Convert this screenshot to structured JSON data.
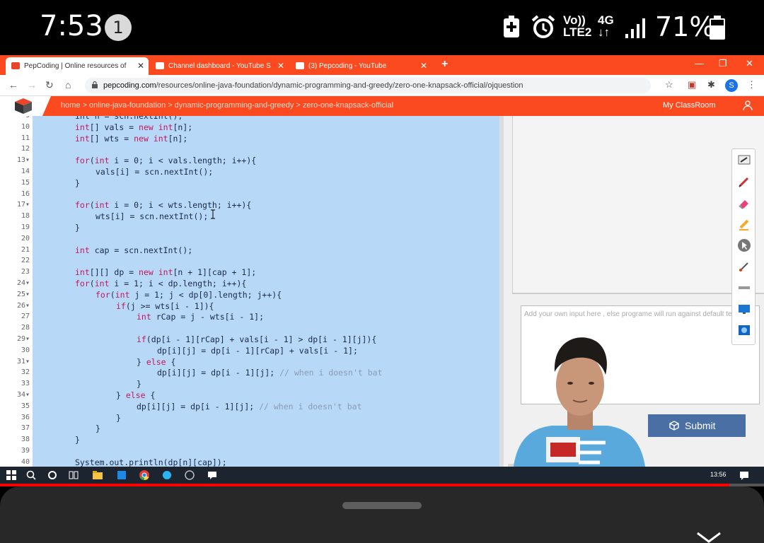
{
  "status_bar": {
    "time": "7:53",
    "notification_count": "1",
    "volte_line1": "Vo))",
    "volte_line2": "LTE2",
    "network_line1": "4G",
    "network_line2": "↓↑",
    "battery_percent": "71%",
    "icons": [
      "battery-saver-icon",
      "alarm-icon",
      "signal-icon",
      "battery-icon"
    ]
  },
  "browser": {
    "tabs": [
      {
        "label": "PepCoding | Online resources of",
        "active": true
      },
      {
        "label": "Channel dashboard - YouTube S",
        "active": false
      },
      {
        "label": "(3) Pepcoding - YouTube",
        "active": false
      }
    ],
    "url_host": "pepcoding.com",
    "url_path": "/resources/online-java-foundation/dynamic-programming-and-greedy/zero-one-knapsack-official/ojquestion"
  },
  "site": {
    "breadcrumb": [
      "home",
      "online-java-foundation",
      "dynamic-programming-and-greedy",
      "zero-one-knapsack-official"
    ],
    "breadcrumb_sep": ">",
    "my_classroom": "My ClassRoom"
  },
  "editor": {
    "lines": [
      {
        "n": "9",
        "indent": 0,
        "parts": [
          [
            "int n = scn.nextInt();",
            "p"
          ]
        ]
      },
      {
        "n": "10",
        "indent": 0,
        "parts": [
          [
            "int",
            "k"
          ],
          [
            "[] vals = ",
            "p"
          ],
          [
            "new int",
            "k"
          ],
          [
            "[n];",
            "p"
          ]
        ]
      },
      {
        "n": "11",
        "indent": 0,
        "parts": [
          [
            "int",
            "k"
          ],
          [
            "[] wts = ",
            "p"
          ],
          [
            "new int",
            "k"
          ],
          [
            "[n];",
            "p"
          ]
        ]
      },
      {
        "n": "12",
        "indent": 0,
        "parts": []
      },
      {
        "n": "13",
        "indent": 0,
        "parts": [
          [
            "for",
            "k"
          ],
          [
            "(",
            "p"
          ],
          [
            "int",
            "k"
          ],
          [
            " i = 0; i < vals.length; i++){",
            "p"
          ]
        ]
      },
      {
        "n": "14",
        "indent": 1,
        "parts": [
          [
            "vals[i] = scn.nextInt();",
            "p"
          ]
        ]
      },
      {
        "n": "15",
        "indent": 0,
        "parts": [
          [
            "}",
            "p"
          ]
        ]
      },
      {
        "n": "16",
        "indent": 0,
        "parts": []
      },
      {
        "n": "17",
        "indent": 0,
        "parts": [
          [
            "for",
            "k"
          ],
          [
            "(",
            "p"
          ],
          [
            "int",
            "k"
          ],
          [
            " i = 0; i < wts.length; i++){",
            "p"
          ]
        ]
      },
      {
        "n": "18",
        "indent": 1,
        "parts": [
          [
            "wts[i] = scn.nextInt();",
            "p"
          ]
        ]
      },
      {
        "n": "19",
        "indent": 0,
        "parts": [
          [
            "}",
            "p"
          ]
        ]
      },
      {
        "n": "20",
        "indent": 0,
        "parts": []
      },
      {
        "n": "21",
        "indent": 0,
        "parts": [
          [
            "int",
            "k"
          ],
          [
            " cap = scn.nextInt();",
            "p"
          ]
        ]
      },
      {
        "n": "22",
        "indent": 0,
        "parts": []
      },
      {
        "n": "23",
        "indent": 0,
        "parts": [
          [
            "int",
            "k"
          ],
          [
            "[][] dp = ",
            "p"
          ],
          [
            "new int",
            "k"
          ],
          [
            "[n + 1][cap + 1];",
            "p"
          ]
        ]
      },
      {
        "n": "24",
        "indent": 0,
        "parts": [
          [
            "for",
            "k"
          ],
          [
            "(",
            "p"
          ],
          [
            "int",
            "k"
          ],
          [
            " i = 1; i < dp.length; i++){",
            "p"
          ]
        ]
      },
      {
        "n": "25",
        "indent": 1,
        "parts": [
          [
            "for",
            "k"
          ],
          [
            "(",
            "p"
          ],
          [
            "int",
            "k"
          ],
          [
            " j = 1; j < dp[0].length; j++){",
            "p"
          ]
        ]
      },
      {
        "n": "26",
        "indent": 2,
        "parts": [
          [
            "if",
            "k"
          ],
          [
            "(j >= wts[i - 1]){",
            "p"
          ]
        ]
      },
      {
        "n": "27",
        "indent": 3,
        "parts": [
          [
            "int",
            "k"
          ],
          [
            " rCap = j - wts[i - 1];",
            "p"
          ]
        ]
      },
      {
        "n": "28",
        "indent": 0,
        "parts": []
      },
      {
        "n": "29",
        "indent": 3,
        "parts": [
          [
            "if",
            "k"
          ],
          [
            "(dp[i - 1][rCap] + vals[i - 1] > dp[i - 1][j]){",
            "p"
          ]
        ]
      },
      {
        "n": "30",
        "indent": 4,
        "parts": [
          [
            "dp[i][j] = dp[i - 1][rCap] + vals[i - 1];",
            "p"
          ]
        ]
      },
      {
        "n": "31",
        "indent": 3,
        "parts": [
          [
            "} ",
            "p"
          ],
          [
            "else",
            "k"
          ],
          [
            " {",
            "p"
          ]
        ]
      },
      {
        "n": "32",
        "indent": 4,
        "parts": [
          [
            "dp[i][j] = dp[i - 1][j]; ",
            "p"
          ],
          [
            "// when i doesn't bat",
            "c"
          ]
        ]
      },
      {
        "n": "33",
        "indent": 3,
        "parts": [
          [
            "}",
            "p"
          ]
        ]
      },
      {
        "n": "34",
        "indent": 2,
        "parts": [
          [
            "} ",
            "p"
          ],
          [
            "else",
            "k"
          ],
          [
            " {",
            "p"
          ]
        ]
      },
      {
        "n": "35",
        "indent": 3,
        "parts": [
          [
            "dp[i][j] = dp[i - 1][j]; ",
            "p"
          ],
          [
            "// when i doesn't bat",
            "c"
          ]
        ]
      },
      {
        "n": "36",
        "indent": 2,
        "parts": [
          [
            "}",
            "p"
          ]
        ]
      },
      {
        "n": "37",
        "indent": 1,
        "parts": [
          [
            "}",
            "p"
          ]
        ]
      },
      {
        "n": "38",
        "indent": 0,
        "parts": [
          [
            "}",
            "p"
          ]
        ]
      },
      {
        "n": "39",
        "indent": 0,
        "parts": []
      },
      {
        "n": "40",
        "indent": 0,
        "parts": [
          [
            "System.out.println(dp[n][cap]);",
            "p"
          ]
        ]
      }
    ],
    "fold_lines": [
      "13",
      "17",
      "24",
      "25",
      "26",
      "29",
      "31",
      "34"
    ]
  },
  "panel": {
    "input_placeholder": "Add your own input here , else programe will run against default test case",
    "submit_label": "Submit"
  },
  "annotation_tools": [
    "whiteboard-icon",
    "pen-icon",
    "eraser-icon",
    "highlighter-icon",
    "pointer-icon",
    "brush-icon",
    "line-icon",
    "screen-icon",
    "screenshot-icon"
  ],
  "taskbar": {
    "time": "13:56"
  },
  "video": {
    "progress": 0.955
  },
  "colors": {
    "accent": "#fb4a1f",
    "code_selection": "#b8d8f8",
    "keyword": "#c2185b",
    "progress": "#ff0000"
  }
}
